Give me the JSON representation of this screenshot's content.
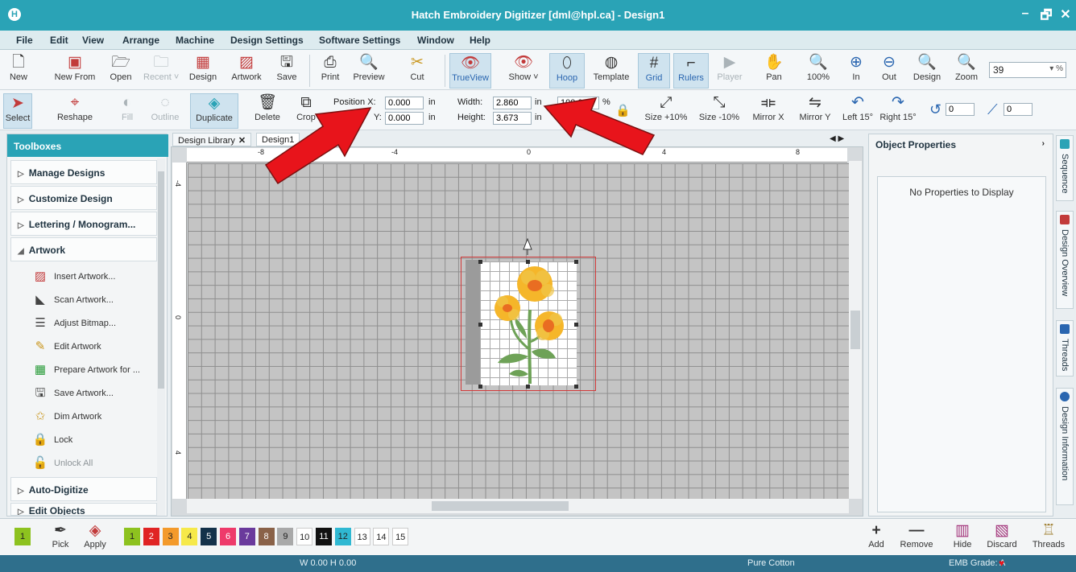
{
  "window": {
    "title": "Hatch Embroidery Digitizer [dml@hpl.ca] - Design1",
    "app_logo": "H",
    "controls": [
      "–",
      "🗗",
      "✕"
    ]
  },
  "menu": [
    "File",
    "Edit",
    "View",
    "Arrange",
    "Machine",
    "Design Settings",
    "Software Settings",
    "Window",
    "Help"
  ],
  "toolbar_top": {
    "new": "New",
    "new_from": "New From",
    "open": "Open",
    "recent": "Recent ˅",
    "design": "Design",
    "artwork": "Artwork",
    "save": "Save",
    "print": "Print",
    "preview": "Preview",
    "cut": "Cut",
    "trueview": "TrueView",
    "show": "Show ˅",
    "hoop": "Hoop",
    "template": "Template",
    "grid": "Grid",
    "rulers": "Rulers",
    "player": "Player",
    "pan": "Pan",
    "zoom100": "100%",
    "zoom_in": "In",
    "zoom_out": "Out",
    "zoom_design": "Design",
    "zoom": "Zoom",
    "zoom_value": "39",
    "zoom_unit": "%"
  },
  "toolbar_edit": {
    "select": "Select",
    "reshape": "Reshape",
    "fill": "Fill",
    "outline": "Outline",
    "duplicate": "Duplicate",
    "delete": "Delete",
    "crop": "Crop",
    "position_x_label": "Position X:",
    "position_y_label": "Y:",
    "position_x": "0.000",
    "position_y": "0.000",
    "pos_unit": "in",
    "width_label": "Width:",
    "height_label": "Height:",
    "width": "2.860",
    "height": "3.673",
    "size_unit": "in",
    "scale": "100.00",
    "scale_unit": "%",
    "size_plus": "Size +10%",
    "size_minus": "Size -10%",
    "mirror_x": "Mirror X",
    "mirror_y": "Mirror Y",
    "left15": "Left 15°",
    "right15": "Right 15°",
    "rotate_value": "0",
    "skew_value": "0"
  },
  "toolbox": {
    "title": "Toolboxes",
    "groups": [
      "Manage Designs",
      "Customize Design",
      "Lettering / Monogram...",
      "Artwork",
      "Auto-Digitize",
      "Edit Objects"
    ],
    "artwork_items": [
      "Insert Artwork...",
      "Scan Artwork...",
      "Adjust Bitmap...",
      "Edit Artwork",
      "Prepare Artwork for ...",
      "Save Artwork...",
      "Dim Artwork",
      "Lock",
      "Unlock All"
    ]
  },
  "tabs": {
    "design_library": "Design Library",
    "design1": "Design1"
  },
  "ruler": {
    "h_labels": [
      "-8",
      "-4",
      "0",
      "4",
      "8"
    ],
    "v_labels": [
      "-4",
      "0",
      "4"
    ]
  },
  "properties": {
    "title": "Object Properties",
    "empty_msg": "No Properties to Display",
    "side_tabs": [
      "Sequence",
      "Design Overview",
      "Threads",
      "Design Information"
    ]
  },
  "palette": {
    "current": "1",
    "pick": "Pick",
    "apply": "Apply",
    "swatches": [
      {
        "n": "1",
        "color": "#8dc21f",
        "fg": "#222"
      },
      {
        "n": "2",
        "color": "#e02424",
        "fg": "#fff"
      },
      {
        "n": "3",
        "color": "#f39a2b",
        "fg": "#222"
      },
      {
        "n": "4",
        "color": "#f6e94a",
        "fg": "#222"
      },
      {
        "n": "5",
        "color": "#14324a",
        "fg": "#fff"
      },
      {
        "n": "6",
        "color": "#ee3a6a",
        "fg": "#fff"
      },
      {
        "n": "7",
        "color": "#6a3a9c",
        "fg": "#fff"
      },
      {
        "n": "8",
        "color": "#8a6248",
        "fg": "#fff"
      },
      {
        "n": "9",
        "color": "#a9a9a9",
        "fg": "#222"
      },
      {
        "n": "10",
        "color": "#ffffff",
        "fg": "#222"
      },
      {
        "n": "11",
        "color": "#111111",
        "fg": "#fff"
      },
      {
        "n": "12",
        "color": "#2fb8d2",
        "fg": "#222"
      },
      {
        "n": "13",
        "color": "#ffffff",
        "fg": "#222"
      },
      {
        "n": "14",
        "color": "#ffffff",
        "fg": "#222"
      },
      {
        "n": "15",
        "color": "#ffffff",
        "fg": "#222"
      }
    ],
    "add": "Add",
    "remove": "Remove",
    "hide": "Hide",
    "discard": "Discard",
    "threads": "Threads"
  },
  "status": {
    "dims": "W 0.00 H 0.00",
    "fabric": "Pure Cotton",
    "grade": "EMB Grade: A"
  },
  "colors": {
    "titlebar": "#2aa3b6",
    "arrow": "#e8141b",
    "selection": "#d23a3a"
  }
}
